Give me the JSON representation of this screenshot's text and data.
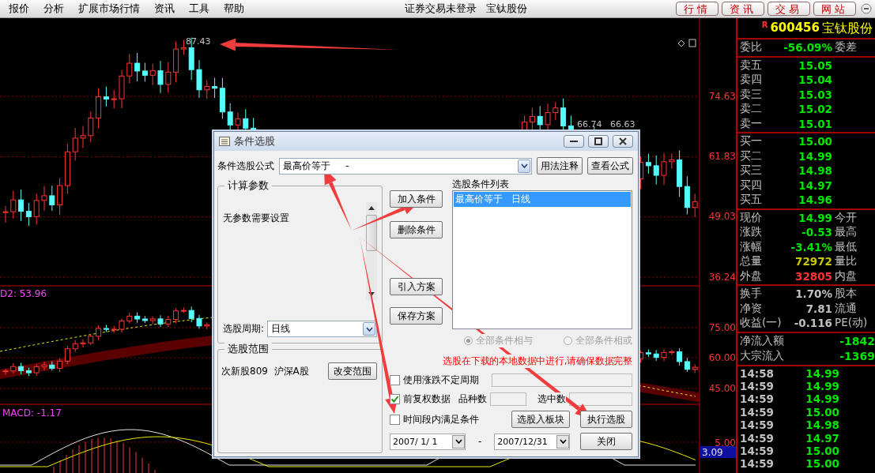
{
  "menu_bar": {
    "menus": [
      "报价",
      "分析",
      "扩展市场行情",
      "资讯",
      "工具",
      "帮助"
    ],
    "status": "证券交易未登录",
    "stock_name": "宝钛股份",
    "nav_buttons": [
      "行情",
      "资讯",
      "交易",
      "网站"
    ]
  },
  "price_chart": {
    "peak_label": "87.43",
    "level_labels": [
      "66.74",
      "66.63"
    ],
    "axis_labels": [
      "74.63",
      "61.83",
      "49.03",
      "36.24"
    ]
  },
  "indicator_chart": {
    "title": "D2: 53.96",
    "axis_labels": [
      "75.00",
      "60.00",
      "45.00"
    ]
  },
  "macd_chart": {
    "title": "MACD: -1.17",
    "axis_labels": [
      "5.00"
    ],
    "current_value": "3.09"
  },
  "quote_panel": {
    "badge": "R",
    "code": "600456",
    "name": "宝钛股份",
    "sections": [
      [
        {
          "label": "委比",
          "value": "-56.09%",
          "color": "#00e600",
          "label_2": "委差"
        }
      ],
      [
        {
          "label": "卖五",
          "value": "15.05",
          "color": "#00e600"
        },
        {
          "label": "卖四",
          "value": "15.04",
          "color": "#00e600"
        },
        {
          "label": "卖三",
          "value": "15.03",
          "color": "#00e600"
        },
        {
          "label": "卖二",
          "value": "15.02",
          "color": "#00e600"
        },
        {
          "label": "卖一",
          "value": "15.01",
          "color": "#00e600"
        }
      ],
      [
        {
          "label": "买一",
          "value": "15.00",
          "color": "#00e600"
        },
        {
          "label": "买二",
          "value": "14.99",
          "color": "#00e600"
        },
        {
          "label": "买三",
          "value": "14.98",
          "color": "#00e600"
        },
        {
          "label": "买四",
          "value": "14.97",
          "color": "#00e600"
        },
        {
          "label": "买五",
          "value": "14.96",
          "color": "#00e600"
        }
      ],
      [
        {
          "label": "现价",
          "value": "14.99",
          "color": "#00e600",
          "label_2": "今开"
        },
        {
          "label": "涨跌",
          "value": "-0.53",
          "color": "#00e600",
          "label_2": "最高"
        },
        {
          "label": "涨幅",
          "value": "-3.41%",
          "color": "#00e600",
          "label_2": "最低"
        },
        {
          "label": "总量",
          "value": "72972",
          "color": "#c8c800",
          "label_2": "量比"
        },
        {
          "label": "外盘",
          "value": "32805",
          "color": "#ff3232",
          "label_2": "内盘"
        }
      ],
      [
        {
          "label": "换手",
          "value": "1.70%",
          "color": "#c0c0c0",
          "label_2": "股本"
        },
        {
          "label": "净资",
          "value": "7.81",
          "color": "#c0c0c0",
          "label_2": "流通"
        },
        {
          "label": "收益(一)",
          "value": "-0.116",
          "color": "#c0c0c0",
          "label_2": "PE(动)"
        }
      ]
    ],
    "flows": [
      {
        "label": "净流入额",
        "value": "-1842"
      },
      {
        "label": "大宗流入",
        "value": "-1369"
      }
    ],
    "ticks": [
      {
        "time": "14:58",
        "price": "14.99"
      },
      {
        "time": "14:59",
        "price": "14.99"
      },
      {
        "time": "14:59",
        "price": "14.99"
      },
      {
        "time": "14:59",
        "price": "15.00"
      },
      {
        "time": "14:59",
        "price": "14.98"
      },
      {
        "time": "14:59",
        "price": "14.97"
      },
      {
        "time": "14:59",
        "price": "15.00"
      },
      {
        "time": "14:59",
        "price": "15.00"
      }
    ]
  },
  "dialog": {
    "title": "条件选股",
    "formula_label": "条件选股公式",
    "formula_value": "最高价等于     -",
    "formula_buttons": [
      "用法注释",
      "查看公式"
    ],
    "params_group": {
      "title": "计算参数",
      "text": "无参数需要设置",
      "period_label": "选股周期:",
      "period_value": "日线"
    },
    "scope_group": {
      "title": "选股范围",
      "text": "次新股809  沪深A股",
      "button": "改变范围"
    },
    "action_buttons": [
      "加入条件",
      "删除条件",
      "引入方案",
      "保存方案"
    ],
    "conditions": {
      "title": "选股条件列表",
      "items": [
        {
          "text": "最高价等于   日线",
          "selected": true
        }
      ]
    },
    "logic_options": [
      {
        "label": "全部条件相与",
        "selected": true,
        "disabled": true
      },
      {
        "label": "全部条件相或",
        "selected": false,
        "disabled": true
      }
    ],
    "notice": "选股在下载的本地数据中进行,请确保数据完整",
    "options": [
      {
        "label": "使用涨跌不定周期",
        "checked": false
      },
      {
        "label": "前复权数据",
        "checked": true
      },
      {
        "label": "时间段内满足条件",
        "checked": false
      }
    ],
    "count_labels": [
      "品种数",
      "选中数"
    ],
    "date_from": "2007/ 1/ 1",
    "date_separator": "-",
    "date_to": "2007/12/31",
    "bottom_buttons": [
      "选股入板块",
      "执行选股",
      "关闭"
    ]
  }
}
